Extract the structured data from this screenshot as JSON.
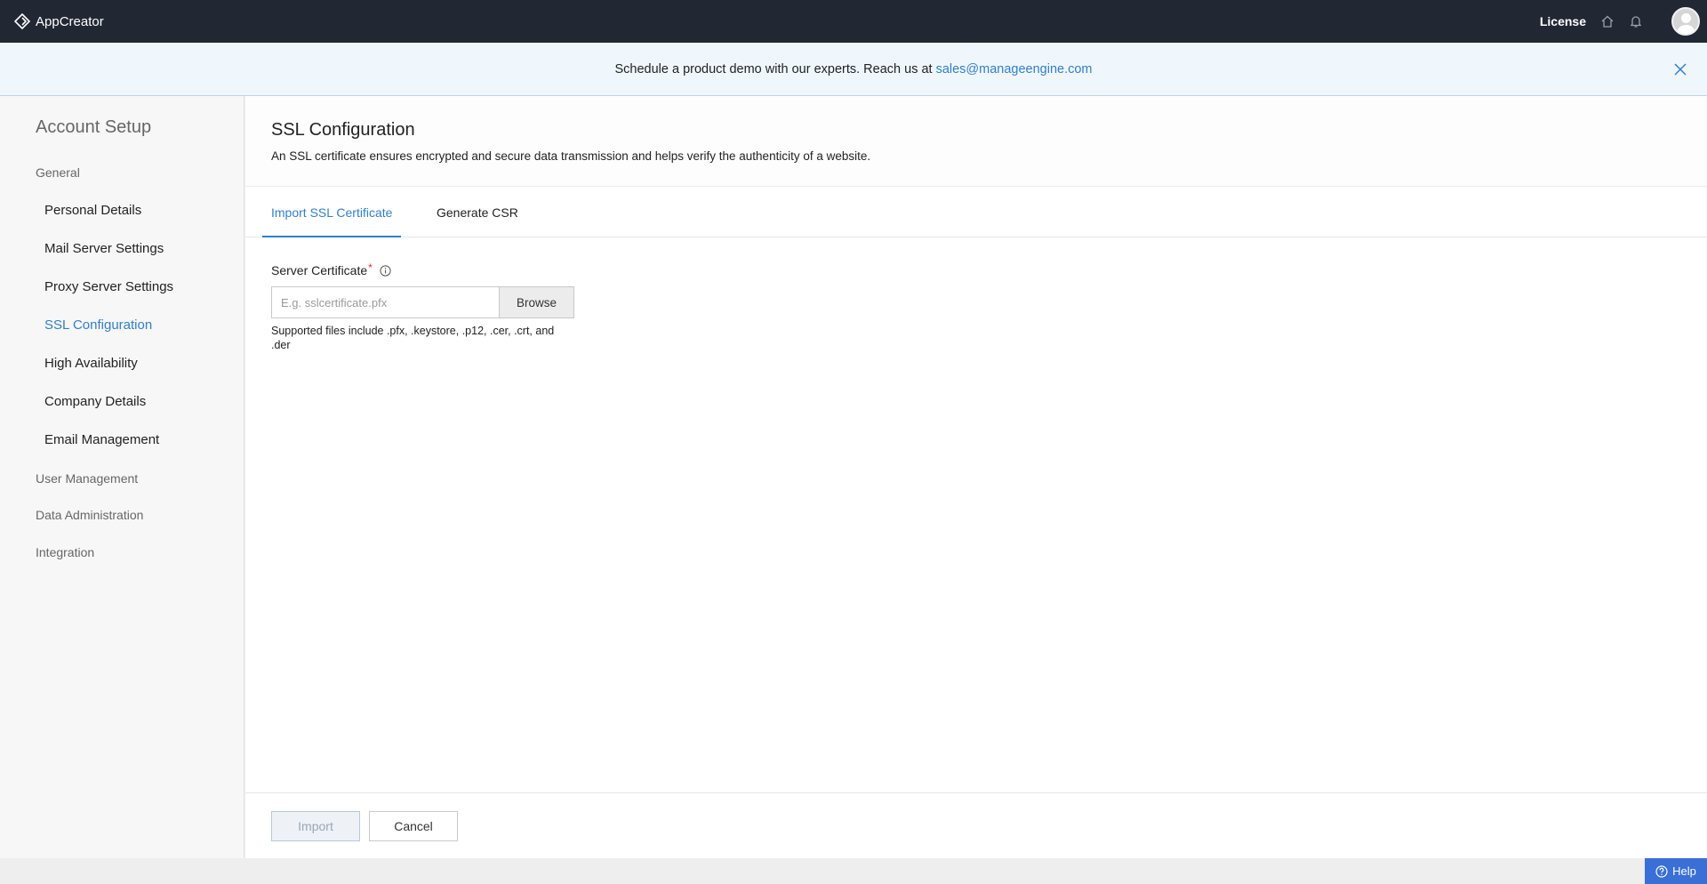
{
  "topbar": {
    "app_name": "AppCreator",
    "license_label": "License",
    "icons": [
      "appcreator-logo-icon",
      "home-icon",
      "bell-icon",
      "avatar"
    ]
  },
  "banner": {
    "text": "Schedule a product demo with our experts. Reach us at",
    "email": "sales@manageengine.com"
  },
  "sidebar": {
    "title": "Account Setup",
    "groups": [
      {
        "label": "General"
      },
      {
        "label": "User Management"
      },
      {
        "label": "Data Administration"
      },
      {
        "label": "Integration"
      }
    ],
    "items": [
      {
        "label": "Personal Details"
      },
      {
        "label": "Mail Server Settings"
      },
      {
        "label": "Proxy Server Settings"
      },
      {
        "label": "SSL Configuration",
        "active": true
      },
      {
        "label": "High Availability"
      },
      {
        "label": "Company Details"
      },
      {
        "label": "Email Management"
      }
    ]
  },
  "main": {
    "title": "SSL Configuration",
    "description": "An SSL certificate ensures encrypted and secure data transmission and helps verify the authenticity of a website.",
    "tabs": [
      {
        "label": "Import SSL Certificate",
        "active": true
      },
      {
        "label": "Generate CSR"
      }
    ],
    "form": {
      "label": "Server Certificate",
      "required_mark": "*",
      "placeholder": "E.g. sslcertificate.pfx",
      "value": "",
      "browse_label": "Browse",
      "help": "Supported files include .pfx, .keystore, .p12, .cer, .crt, and .der"
    },
    "footer": {
      "import_label": "Import",
      "cancel_label": "Cancel"
    }
  },
  "help_button": {
    "label": "Help"
  },
  "colors": {
    "topbar": "#222734",
    "accent": "#2f7fd0",
    "banner_bg": "#f0f7fc",
    "help_button": "#3a6fd8"
  }
}
